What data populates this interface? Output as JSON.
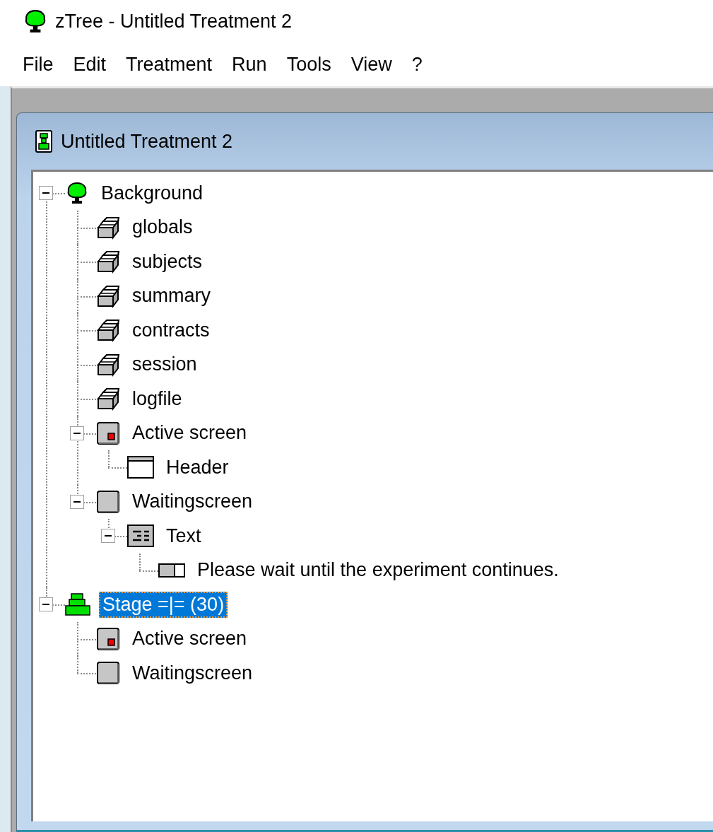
{
  "app": {
    "title": "zTree - Untitled Treatment 2"
  },
  "menu": [
    "File",
    "Edit",
    "Treatment",
    "Run",
    "Tools",
    "View",
    "?"
  ],
  "document": {
    "title": "Untitled Treatment 2",
    "tree": [
      {
        "label": "Background",
        "kind": "tree",
        "selected": false,
        "expanded": true,
        "children": [
          {
            "label": "globals",
            "kind": "table",
            "selected": false
          },
          {
            "label": "subjects",
            "kind": "table",
            "selected": false
          },
          {
            "label": "summary",
            "kind": "table",
            "selected": false
          },
          {
            "label": "contracts",
            "kind": "table",
            "selected": false
          },
          {
            "label": "session",
            "kind": "table",
            "selected": false
          },
          {
            "label": "logfile",
            "kind": "table",
            "selected": false
          },
          {
            "label": "Active screen",
            "kind": "active-screen",
            "selected": false,
            "expanded": true,
            "children": [
              {
                "label": "Header",
                "kind": "header",
                "selected": false
              }
            ]
          },
          {
            "label": "Waitingscreen",
            "kind": "screen",
            "selected": false,
            "expanded": true,
            "children": [
              {
                "label": "Text",
                "kind": "text",
                "selected": false,
                "expanded": true,
                "children": [
                  {
                    "label": "Please wait until the experiment continues.",
                    "kind": "item",
                    "selected": false
                  }
                ]
              }
            ]
          }
        ]
      },
      {
        "label": "Stage =|= (30)",
        "kind": "stage",
        "selected": true,
        "expanded": true,
        "children": [
          {
            "label": "Active screen",
            "kind": "active-screen",
            "selected": false
          },
          {
            "label": "Waitingscreen",
            "kind": "screen",
            "selected": false
          }
        ]
      }
    ]
  }
}
